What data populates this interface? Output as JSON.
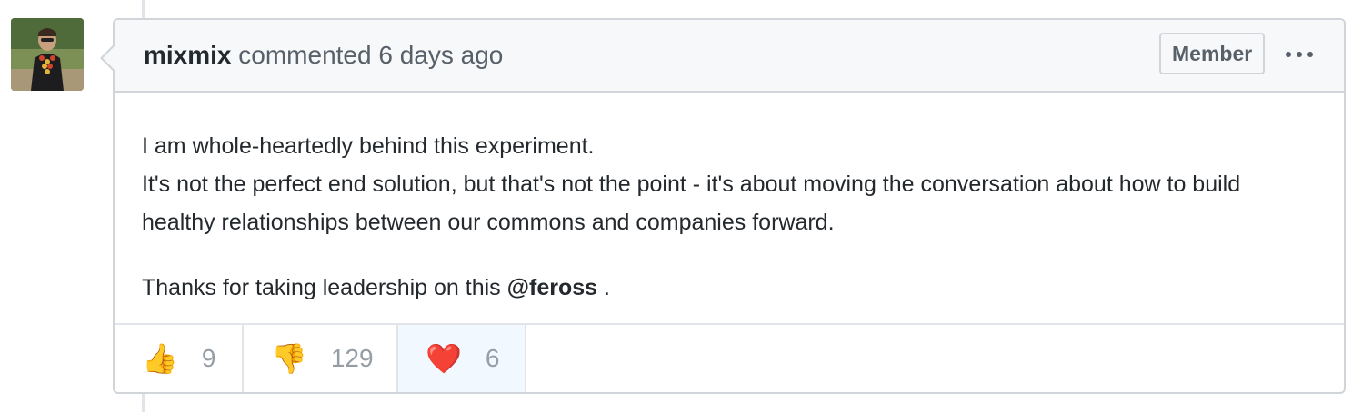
{
  "comment": {
    "author": "mixmix",
    "action": "commented",
    "time": "6 days ago",
    "badge": "Member",
    "more_icon": "kebab-horizontal-icon",
    "body": {
      "line1": "I am whole-heartedly behind this experiment.",
      "line2": "It's not the perfect end solution, but that's not the point - it's about moving the conversation about how to build healthy relationships between our commons and companies forward.",
      "thanks_prefix": "Thanks for taking leadership on this ",
      "mention": "@feross",
      "thanks_suffix": " ."
    },
    "reactions": [
      {
        "icon": "thumbs-up-icon",
        "glyph": "👍",
        "count": "9",
        "selected": false
      },
      {
        "icon": "thumbs-down-icon",
        "glyph": "👎",
        "count": "129",
        "selected": false
      },
      {
        "icon": "heart-icon",
        "glyph": "❤️",
        "count": "6",
        "selected": true
      }
    ]
  },
  "colors": {
    "header_bg": "#f6f8fa",
    "border": "#d1d5da",
    "selected_reaction_bg": "#f1f8ff"
  }
}
